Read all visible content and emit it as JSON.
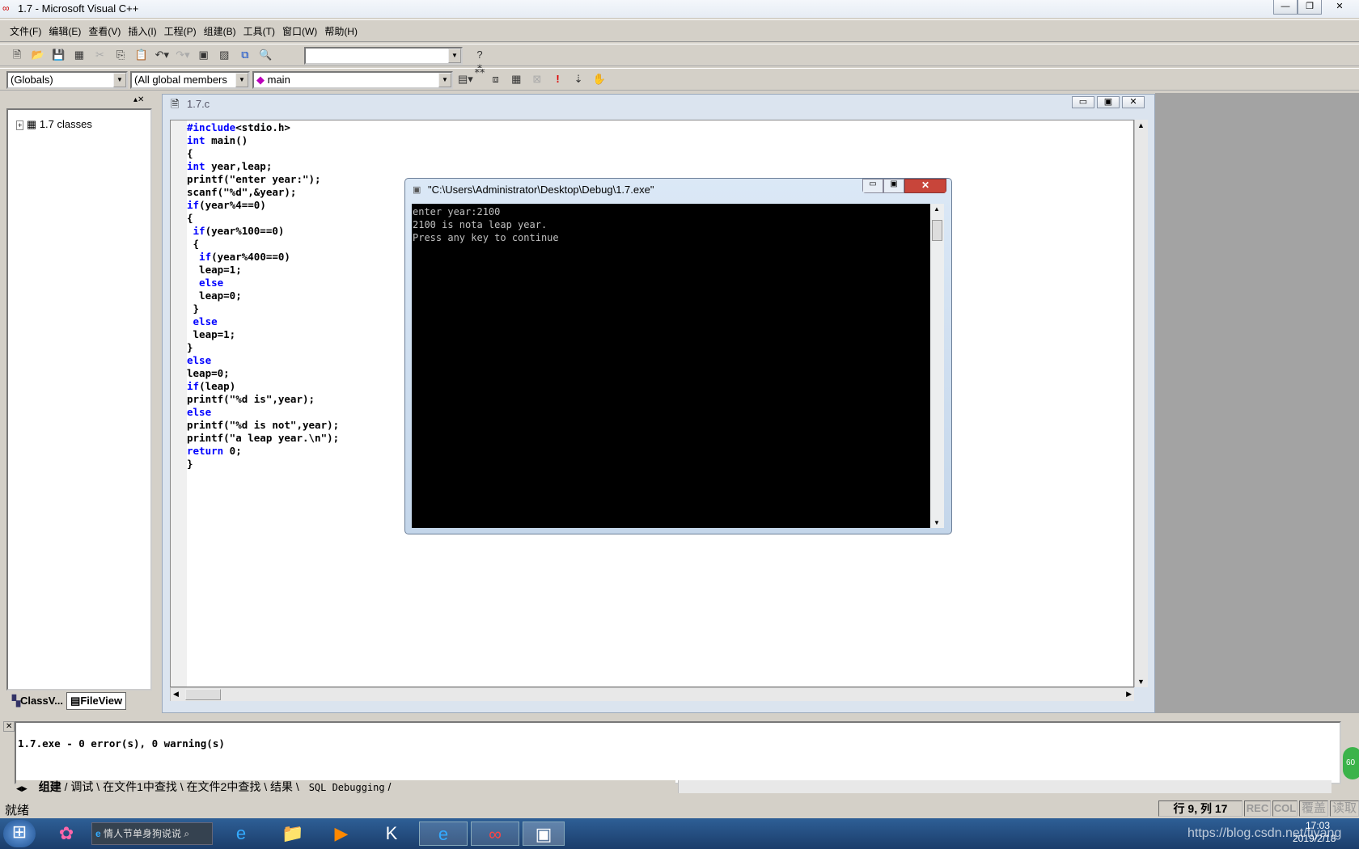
{
  "window": {
    "title": "1.7 - Microsoft Visual C++",
    "min": "—",
    "restore": "❐",
    "close": "✕"
  },
  "menu": [
    "文件(F)",
    "编辑(E)",
    "查看(V)",
    "插入(I)",
    "工程(P)",
    "组建(B)",
    "工具(T)",
    "窗口(W)",
    "帮助(H)"
  ],
  "toolbar": {
    "find_value": ""
  },
  "wizardbar": {
    "scope": "(Globals)",
    "members": "(All global members",
    "function": "main"
  },
  "workspace": {
    "tree_root": "1.7 classes",
    "tabs": [
      "ClassV...",
      "FileView"
    ]
  },
  "editor": {
    "title": "1.7.c",
    "lines": [
      [
        [
          "kw",
          "#include"
        ],
        [
          "",
          "<stdio.h>"
        ]
      ],
      [
        [
          "kw",
          "int"
        ],
        [
          "",
          " main()"
        ]
      ],
      [
        [
          "",
          "{"
        ]
      ],
      [
        [
          "kw",
          "int"
        ],
        [
          "",
          " year,leap;"
        ]
      ],
      [
        [
          "",
          "printf(\"enter year:\");"
        ]
      ],
      [
        [
          "",
          "scanf(\"%d\",&year);"
        ]
      ],
      [
        [
          "kw",
          "if"
        ],
        [
          "",
          "(year%4==0)"
        ]
      ],
      [
        [
          "",
          "{"
        ]
      ],
      [
        [
          "kw",
          " if"
        ],
        [
          "",
          "(year%100==0)"
        ]
      ],
      [
        [
          "",
          " {"
        ]
      ],
      [
        [
          "kw",
          "  if"
        ],
        [
          "",
          "(year%400==0)"
        ]
      ],
      [
        [
          "",
          "  leap=1;"
        ]
      ],
      [
        [
          "kw",
          "  else"
        ]
      ],
      [
        [
          "",
          "  leap=0;"
        ]
      ],
      [
        [
          "",
          " }"
        ]
      ],
      [
        [
          "kw",
          " else"
        ]
      ],
      [
        [
          "",
          " leap=1;"
        ]
      ],
      [
        [
          "",
          "}"
        ]
      ],
      [
        [
          "kw",
          "else"
        ]
      ],
      [
        [
          "",
          "leap=0;"
        ]
      ],
      [
        [
          "kw",
          "if"
        ],
        [
          "",
          "(leap)"
        ]
      ],
      [
        [
          "",
          "printf(\"%d is\",year);"
        ]
      ],
      [
        [
          "kw",
          "else"
        ]
      ],
      [
        [
          "",
          "printf(\"%d is not\",year);"
        ]
      ],
      [
        [
          "",
          "printf(\"a leap year.\\n\");"
        ]
      ],
      [
        [
          "kw",
          "return"
        ],
        [
          "",
          " 0;"
        ]
      ],
      [
        [
          "",
          "}"
        ]
      ]
    ]
  },
  "console": {
    "title": "\"C:\\Users\\Administrator\\Desktop\\Debug\\1.7.exe\"",
    "lines": [
      "enter year:2100",
      "2100 is nota leap year.",
      "Press any key to continue"
    ]
  },
  "output": {
    "text": "1.7.exe - 0 error(s), 0 warning(s)",
    "tabs": [
      "组建",
      "调试",
      "在文件1中查找",
      "在文件2中查找",
      "结果",
      "SQL Debugging"
    ]
  },
  "status": {
    "text": "就绪",
    "position": "行 9, 列 17",
    "rec": "REC",
    "col": "COL",
    "ovr": "覆盖",
    "read": "读取"
  },
  "taskbar": {
    "search": "情人节单身狗说说",
    "time": "17:03",
    "date": "2019/2/18",
    "watermark": "https://blog.csdn.net/fiyang",
    "badge": "60"
  }
}
